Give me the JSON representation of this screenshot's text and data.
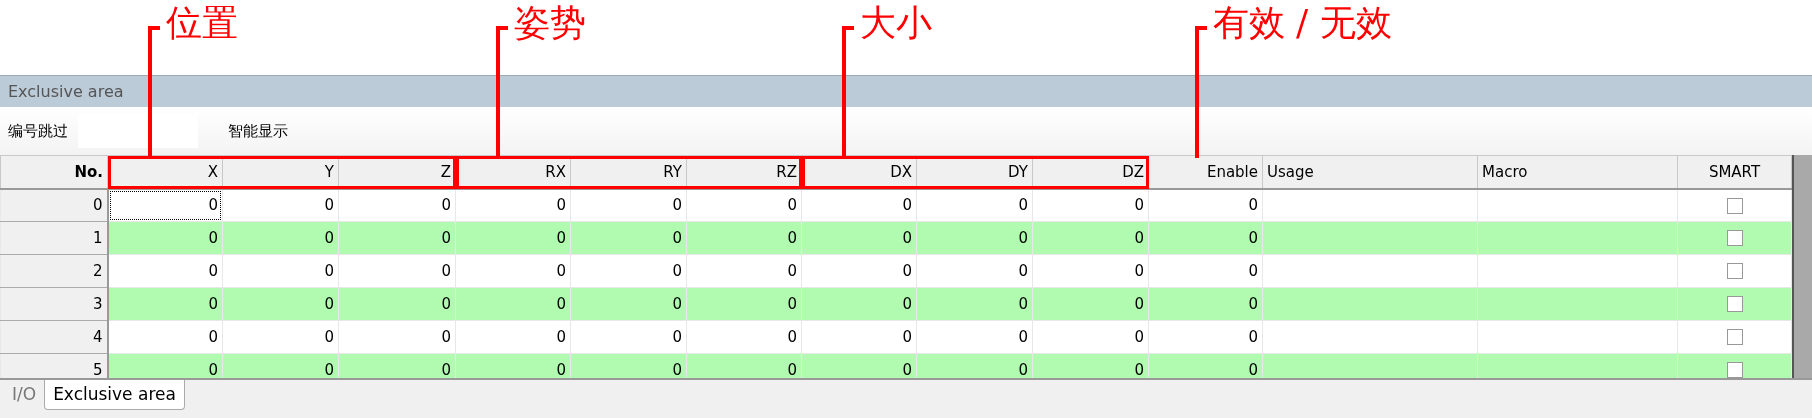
{
  "panel": {
    "title": "Exclusive area"
  },
  "toolbar": {
    "skip_label": "编号跳过",
    "smart_label": "智能显示"
  },
  "header": [
    {
      "kind": "index",
      "label": "No."
    },
    {
      "kind": "group",
      "annotation": "位置",
      "boxed": true,
      "columns": [
        {
          "label": "X",
          "kind": "number"
        },
        {
          "label": "Y",
          "kind": "number"
        },
        {
          "label": "Z",
          "kind": "number"
        }
      ]
    },
    {
      "kind": "group",
      "annotation": "姿势",
      "boxed": true,
      "columns": [
        {
          "label": "RX",
          "kind": "number"
        },
        {
          "label": "RY",
          "kind": "number"
        },
        {
          "label": "RZ",
          "kind": "number"
        }
      ]
    },
    {
      "kind": "group",
      "annotation": "大小",
      "boxed": true,
      "columns": [
        {
          "label": "DX",
          "kind": "number"
        },
        {
          "label": "DY",
          "kind": "number"
        },
        {
          "label": "DZ",
          "kind": "number"
        }
      ]
    },
    {
      "kind": "group",
      "annotation": "有效 / 无效",
      "boxed": false,
      "columns": [
        {
          "label": "Enable",
          "kind": "number"
        }
      ]
    },
    {
      "kind": "text",
      "label": "Usage"
    },
    {
      "kind": "text",
      "label": "Macro"
    },
    {
      "kind": "check",
      "label": "SMART"
    }
  ],
  "rows": [
    {
      "no": "0",
      "values": [
        "0",
        "0",
        "0",
        "0",
        "0",
        "0",
        "0",
        "0",
        "0",
        "0"
      ],
      "smart": false,
      "current": true
    },
    {
      "no": "1",
      "values": [
        "0",
        "0",
        "0",
        "0",
        "0",
        "0",
        "0",
        "0",
        "0",
        "0"
      ],
      "smart": false,
      "current": false
    },
    {
      "no": "2",
      "values": [
        "0",
        "0",
        "0",
        "0",
        "0",
        "0",
        "0",
        "0",
        "0",
        "0"
      ],
      "smart": false,
      "current": false
    },
    {
      "no": "3",
      "values": [
        "0",
        "0",
        "0",
        "0",
        "0",
        "0",
        "0",
        "0",
        "0",
        "0"
      ],
      "smart": false,
      "current": false
    },
    {
      "no": "4",
      "values": [
        "0",
        "0",
        "0",
        "0",
        "0",
        "0",
        "0",
        "0",
        "0",
        "0"
      ],
      "smart": false,
      "current": false
    },
    {
      "no": "5",
      "values": [
        "0",
        "0",
        "0",
        "0",
        "0",
        "0",
        "0",
        "0",
        "0",
        "0"
      ],
      "smart": false,
      "current": false
    }
  ],
  "tabs": [
    {
      "label": "I/O",
      "selected": false
    },
    {
      "label": "Exclusive area",
      "selected": true
    }
  ]
}
